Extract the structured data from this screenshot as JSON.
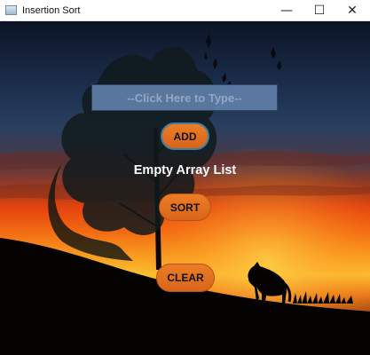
{
  "window": {
    "title": "Insertion Sort",
    "controls": {
      "minimize": "—",
      "maximize": "☐",
      "close": "✕"
    }
  },
  "input": {
    "placeholder": "--Click Here to Type--",
    "value": ""
  },
  "buttons": {
    "add": "ADD",
    "sort": "SORT",
    "clear": "CLEAR"
  },
  "status": {
    "text": "Empty Array List"
  },
  "colors": {
    "button": "#e67322",
    "input": "#607ea8",
    "sky_top": "#0c1424",
    "sunset": "#f25a12"
  }
}
